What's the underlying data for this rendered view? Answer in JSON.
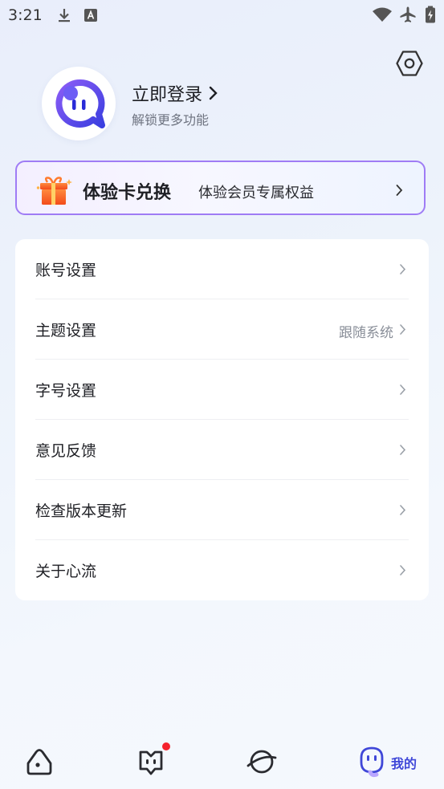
{
  "status_bar": {
    "time": "3:21",
    "icons": [
      "download-icon",
      "keyboard-a-icon",
      "wifi-icon",
      "airplane-icon",
      "battery-charging-icon"
    ]
  },
  "header": {
    "settings_icon": "hexagon-settings-icon",
    "login_title": "立即登录",
    "login_subtitle": "解锁更多功能"
  },
  "exchange_card": {
    "title": "体验卡兑换",
    "subtitle": "体验会员专属权益",
    "border_color": "#9f7cf5"
  },
  "menu": {
    "items": [
      {
        "label": "账号设置",
        "value": ""
      },
      {
        "label": "主题设置",
        "value": "跟随系统"
      },
      {
        "label": "字号设置",
        "value": ""
      },
      {
        "label": "意见反馈",
        "value": ""
      },
      {
        "label": "检查版本更新",
        "value": ""
      },
      {
        "label": "关于心流",
        "value": ""
      }
    ]
  },
  "tabbar": {
    "tabs": [
      {
        "icon": "home-icon"
      },
      {
        "icon": "chat-bot-icon",
        "badge": true
      },
      {
        "icon": "planet-icon"
      },
      {
        "icon": "profile-mascot-icon",
        "label": "我的",
        "active": true
      }
    ],
    "accent": "#3f47d8"
  }
}
